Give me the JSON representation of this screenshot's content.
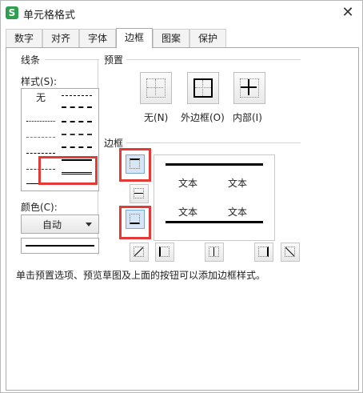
{
  "window": {
    "title": "单元格格式",
    "app_icon_letter": "S",
    "close_glyph": "✕"
  },
  "tabs": [
    {
      "label": "数字"
    },
    {
      "label": "对齐"
    },
    {
      "label": "字体"
    },
    {
      "label": "边框",
      "active": true
    },
    {
      "label": "图案"
    },
    {
      "label": "保护"
    }
  ],
  "line_group": {
    "title": "线条",
    "style_label": "样式(S):",
    "none_label": "无",
    "color_label": "颜色(C):",
    "color_value": "自动"
  },
  "preset_group": {
    "title": "预置",
    "buttons": [
      {
        "label": "无(N)"
      },
      {
        "label": "外边框(O)"
      },
      {
        "label": "内部(I)"
      }
    ]
  },
  "border_group": {
    "title": "边框",
    "preview_text": [
      "文本",
      "文本",
      "文本",
      "文本"
    ]
  },
  "description": "单击预置选项、预览草图及上面的按钮可以添加边框样式。",
  "colors": {
    "highlight": "#e53935",
    "app_green": "#2e9e4f",
    "pressed": "#d6e6f7"
  }
}
